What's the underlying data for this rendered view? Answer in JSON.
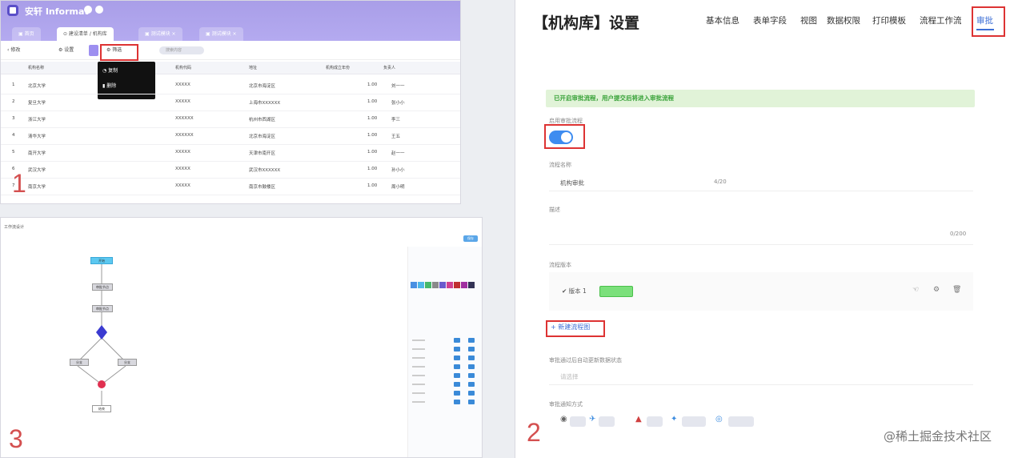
{
  "panel1": {
    "app_title": "安轩 Informat",
    "tabs": [
      "▣ 首页",
      "⊙ 建设清单 / 机构库",
      "▣ 测试模块 ×",
      "▣ 测试模块 ×"
    ],
    "toolbar": {
      "back": "修改",
      "settings": "设置",
      "filter": "筛选",
      "search_placeholder": "搜索内容"
    },
    "menu_items": [
      "复制",
      "删除"
    ],
    "columns": [
      "机构名称",
      "机构代码",
      "地址",
      "机构成立年份",
      "负责人"
    ],
    "rows": [
      [
        "北京大学",
        "XXXXX",
        "北京市海淀区",
        "1.00",
        "刘一一"
      ],
      [
        "复旦大学",
        "XXXXX",
        "上海市XXXXXX",
        "1.00",
        "张小小"
      ],
      [
        "浙江大学",
        "XXXXXX",
        "杭州市西湖区",
        "1.00",
        "李三"
      ],
      [
        "清华大学",
        "XXXXXX",
        "北京市海淀区",
        "1.00",
        "王五"
      ],
      [
        "南开大学",
        "XXXXX",
        "天津市南开区",
        "1.00",
        "赵一一"
      ],
      [
        "武汉大学",
        "XXXXX",
        "武汉市XXXXXX",
        "1.00",
        "孙小小"
      ],
      [
        "南京大学",
        "XXXXX",
        "南京市鼓楼区",
        "1.00",
        "周小明"
      ]
    ],
    "label_number": "1"
  },
  "panel3": {
    "header": "工作流设计",
    "save": "保存",
    "start": "开始",
    "nodes": [
      "审批节点",
      "审批节点",
      "分支",
      "分支",
      "结束"
    ],
    "label_number": "3",
    "swatches": [
      "#4a90e2",
      "#50b8e8",
      "#46b96a",
      "#8a8a8a",
      "#6a5acd",
      "#d04090",
      "#c03030",
      "#a030a0",
      "#333355"
    ]
  },
  "panel2": {
    "title": "【机构库】设置",
    "nav": [
      "基本信息",
      "表单字段",
      "视图",
      "数据权限",
      "打印模板",
      "流程工作流",
      "审批"
    ],
    "banner": "已开启审批流程，用户提交后将进入审批流程",
    "enable_label": "启用审批流程",
    "name_label": "流程名称",
    "name_value": "机构审批",
    "name_count": "4/20",
    "desc_label": "描述",
    "desc_count": "0/200",
    "process_label": "流程版本",
    "version_name": "版本 1",
    "new_version": "+ 新建流程图",
    "approve_label": "审批通过后自动更新数据状态",
    "approve_value": "请选择",
    "notify_label": "审批通知方式",
    "label_number": "2"
  },
  "watermark": "@稀土掘金技术社区"
}
